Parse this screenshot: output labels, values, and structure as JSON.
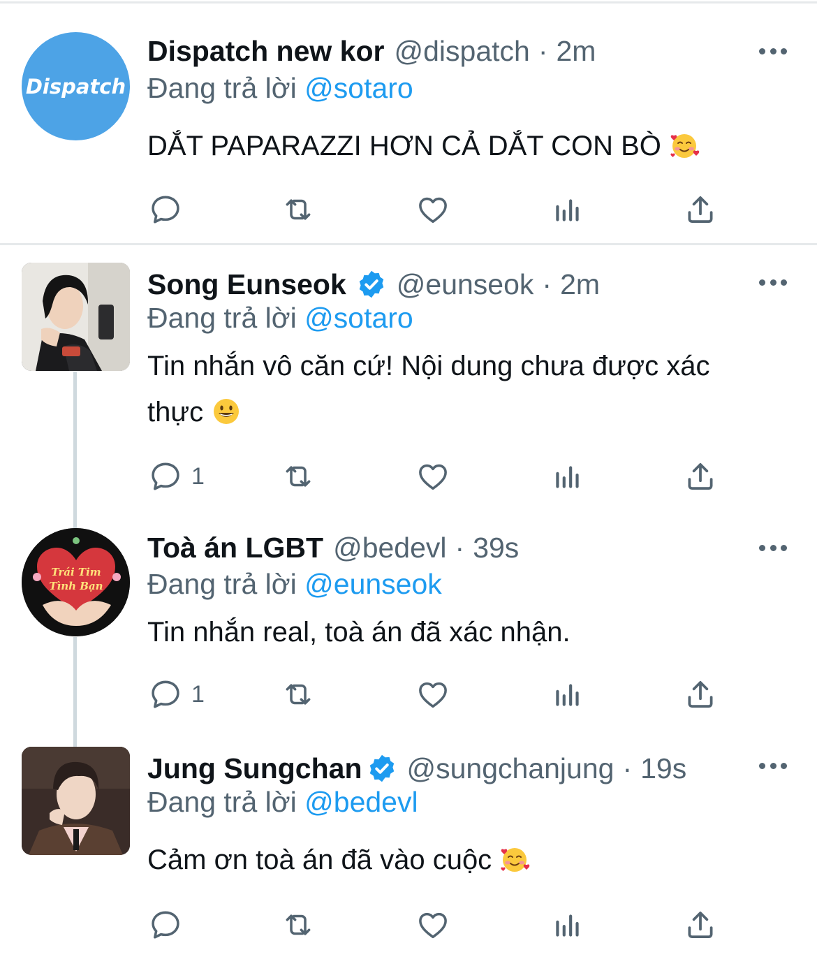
{
  "tweets": [
    {
      "name": "Dispatch new kor",
      "handle": "@dispatch",
      "time": "2m",
      "reply_prefix": "Đang trả lời",
      "reply_to": "@sotaro",
      "text": "DẮT PAPARAZZI HƠN CẢ DẮT CON BÒ",
      "emoji": "smiling-face-with-hearts",
      "avatar_text": "Dispatch",
      "verified": false,
      "reply_count": ""
    },
    {
      "name": "Song Eunseok",
      "handle": "@eunseok",
      "time": "2m",
      "reply_prefix": "Đang trả lời",
      "reply_to": "@sotaro",
      "text": "Tin nhắn vô căn cứ! Nội dung chưa được xác thực",
      "emoji": "grinning-face",
      "verified": true,
      "reply_count": "1"
    },
    {
      "name": "Toà án LGBT",
      "handle": "@bedevl",
      "time": "39s",
      "reply_prefix": "Đang trả lời",
      "reply_to": "@eunseok",
      "text": "Tin nhắn real, toà án đã xác nhận.",
      "avatar_text_line1": "Trái Tim",
      "avatar_text_line2": "Tình Bạn",
      "verified": false,
      "reply_count": "1"
    },
    {
      "name": "Jung Sungchan",
      "handle": "@sungchanjung",
      "time": "19s",
      "reply_prefix": "Đang trả lời",
      "reply_to": "@bedevl",
      "text": "Cảm ơn toà án đã vào cuộc",
      "emoji": "smiling-face-with-hearts",
      "verified": true,
      "reply_count": ""
    }
  ],
  "separator": "·",
  "colors": {
    "accent": "#1d9bf0",
    "secondary_text": "#536471",
    "divider": "#e6e9eb",
    "dispatch_avatar": "#4da3e6"
  },
  "icons": [
    "reply-icon",
    "retweet-icon",
    "like-icon",
    "views-icon",
    "share-icon",
    "verified-badge-icon",
    "more-icon"
  ]
}
